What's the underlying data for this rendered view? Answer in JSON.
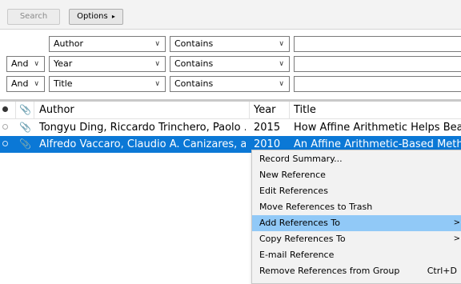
{
  "toolbar": {
    "search_label": "Search",
    "options_label": "Options",
    "options_arrow": "▸"
  },
  "query_rows": [
    {
      "connector": "",
      "field": "Author",
      "operator": "Contains",
      "value": ""
    },
    {
      "connector": "And",
      "field": "Year",
      "operator": "Contains",
      "value": ""
    },
    {
      "connector": "And",
      "field": "Title",
      "operator": "Contains",
      "value": ""
    }
  ],
  "table": {
    "columns": [
      "Author",
      "Year",
      "Title"
    ],
    "rows": [
      {
        "author": "Tongyu Ding, Riccardo Trinchero, Paolo ...",
        "year": "2015",
        "title": "How Affine Arithmetic Helps Beat",
        "selected": false
      },
      {
        "author": "Alfredo Vaccaro, Claudio A. Canizares, a...",
        "year": "2010",
        "title": "An Affine Arithmetic-Based Metho",
        "selected": true
      }
    ]
  },
  "context_menu": {
    "items": [
      {
        "label": "Record Summary...",
        "submenu": false,
        "shortcut": "",
        "highlighted": false
      },
      {
        "label": "New Reference",
        "submenu": false,
        "shortcut": "",
        "highlighted": false
      },
      {
        "label": "Edit References",
        "submenu": false,
        "shortcut": "",
        "highlighted": false
      },
      {
        "label": "Move References to Trash",
        "submenu": false,
        "shortcut": "",
        "highlighted": false
      },
      {
        "label": "Add References To",
        "submenu": true,
        "shortcut": "",
        "highlighted": true
      },
      {
        "label": "Copy References To",
        "submenu": true,
        "shortcut": "",
        "highlighted": false
      },
      {
        "label": "E-mail Reference",
        "submenu": false,
        "shortcut": "",
        "highlighted": false
      },
      {
        "label": "Remove References from Group",
        "submenu": false,
        "shortcut": "Ctrl+D",
        "highlighted": false
      }
    ],
    "submenu_arrow": ">"
  },
  "colors": {
    "selection": "#0b78d6",
    "menu_highlight": "#91c9f7"
  }
}
